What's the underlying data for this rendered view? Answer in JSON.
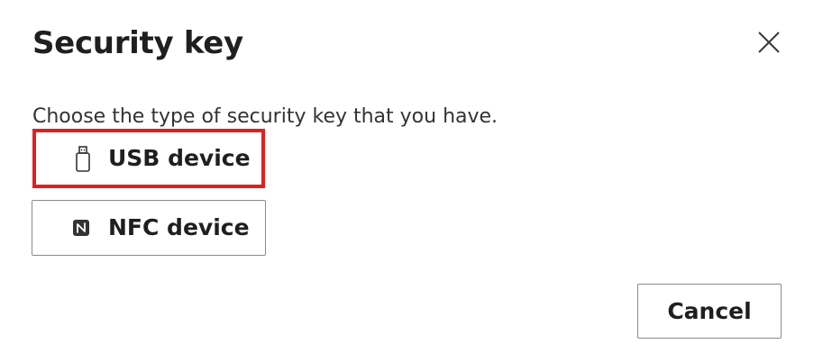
{
  "dialog": {
    "title": "Security key",
    "close_icon": "close-icon",
    "prompt": "Choose the type of security key that you have.",
    "options": [
      {
        "label": "USB device",
        "icon": "usb-drive-icon",
        "highlighted": true
      },
      {
        "label": "NFC device",
        "icon": "nfc-icon",
        "highlighted": false
      }
    ],
    "cancel_label": "Cancel"
  },
  "colors": {
    "highlight_border": "#e02020",
    "button_border": "#8a8a8a",
    "text": "#1f1f1f"
  }
}
